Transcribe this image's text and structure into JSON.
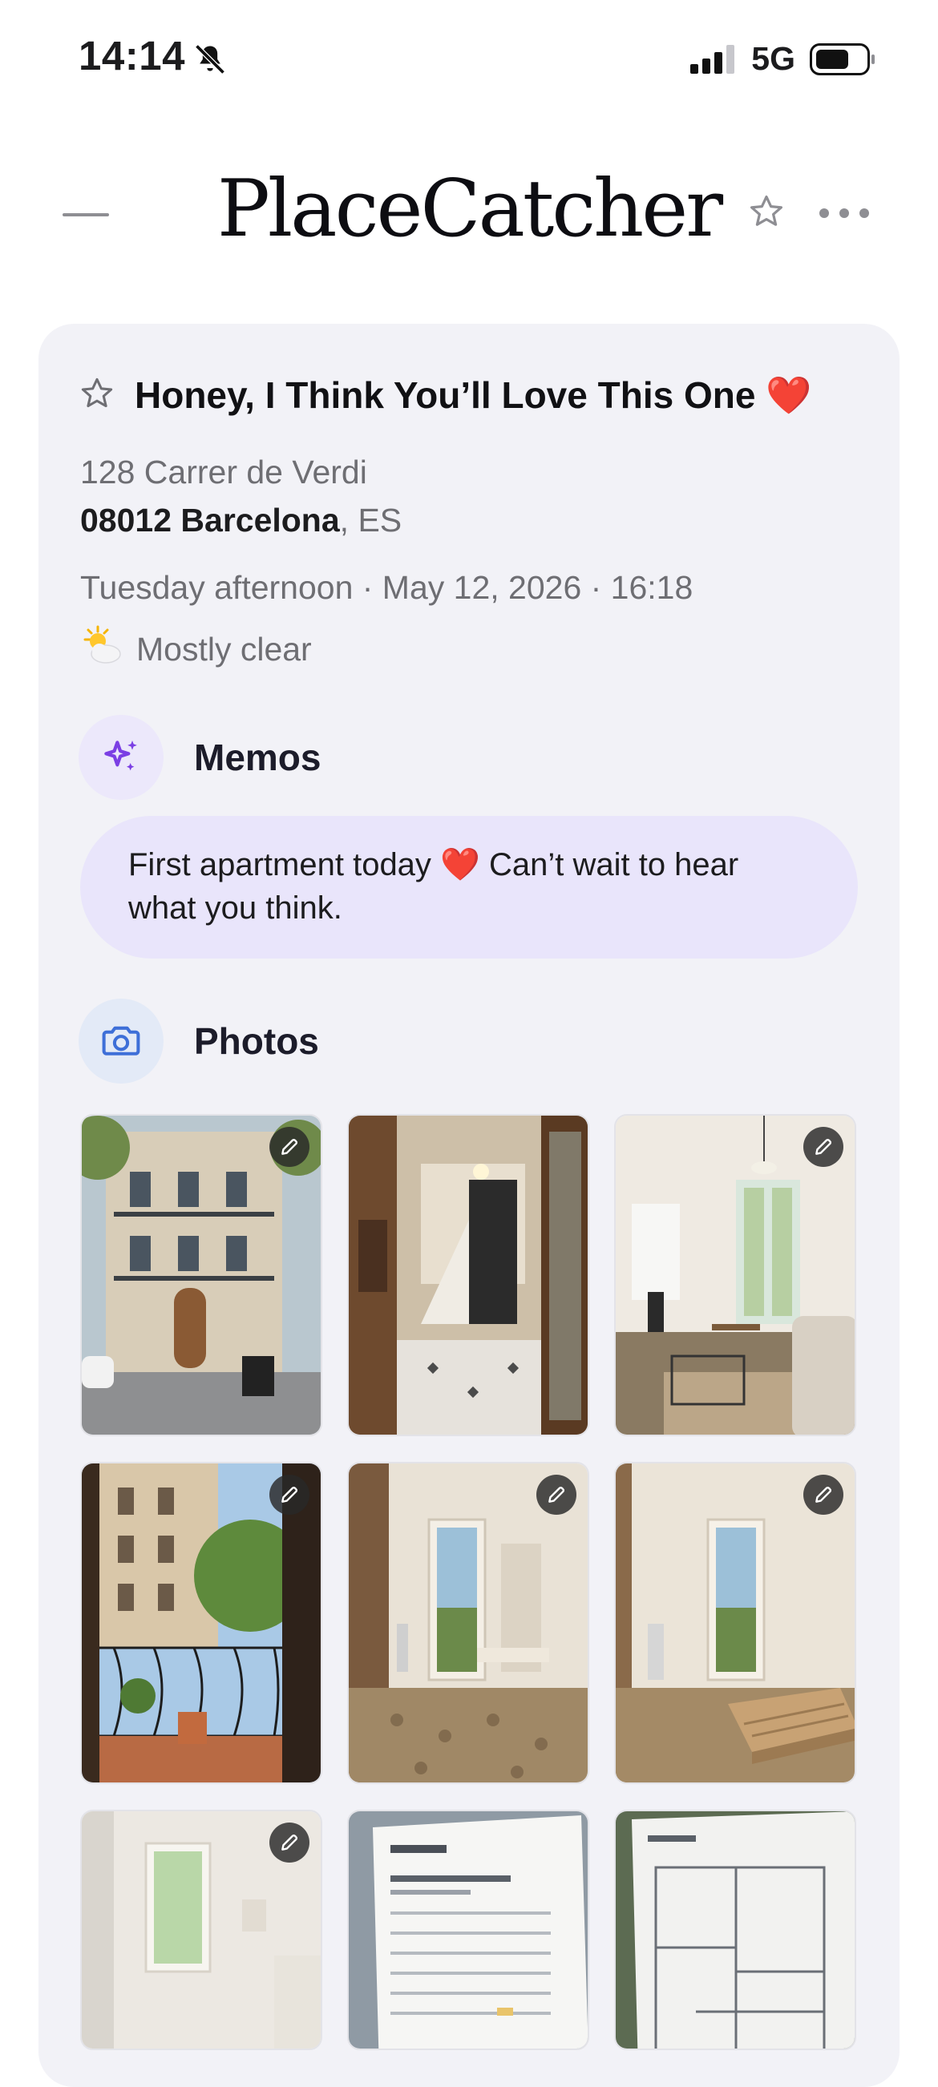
{
  "status_bar": {
    "time": "14:14",
    "network": "5G",
    "icons": [
      "bell-slash-icon",
      "signal-icon",
      "battery-icon"
    ]
  },
  "header": {
    "brand": "PlaceCatcher",
    "left_icon": "menu-line-icon",
    "right_icons": [
      "star-outline-icon",
      "more-dots-icon"
    ]
  },
  "entry": {
    "title": "Honey, I Think You’ll Love This One ❤️",
    "address_line1": "128 Carrer de Verdi",
    "postal_city": "08012 Barcelona",
    "country": ", ES",
    "datetime": "Tuesday afternoon · May 12, 2026 · 16:18",
    "weather": "Mostly clear",
    "weather_icon": "sun-behind-cloud-icon"
  },
  "memos": {
    "label": "Memos",
    "icon": "sparkles-icon",
    "text": "First apartment today ❤️ Can’t wait to hear what you think."
  },
  "photos": {
    "label": "Photos",
    "icon": "camera-icon",
    "items": [
      {
        "subject": "building-exterior",
        "editable": true
      },
      {
        "subject": "entrance-stairwell",
        "editable": false
      },
      {
        "subject": "living-room",
        "editable": true
      },
      {
        "subject": "balcony-view",
        "editable": true
      },
      {
        "subject": "bedroom-window",
        "editable": true
      },
      {
        "subject": "bedroom-bed-frame",
        "editable": true
      },
      {
        "subject": "bathroom",
        "editable": true
      },
      {
        "subject": "apartment-summary-sheet",
        "editable": false
      },
      {
        "subject": "floor-plan",
        "editable": false
      }
    ]
  },
  "colors": {
    "card_bg": "#f2f2f7",
    "memo_bubble": "#e9e5fb",
    "memo_icon_bg": "#ece8fb",
    "memo_icon": "#7b3fe4",
    "photo_icon_bg": "#e3eaf7",
    "photo_icon": "#3e6fd8",
    "heart": "#e0242a"
  }
}
